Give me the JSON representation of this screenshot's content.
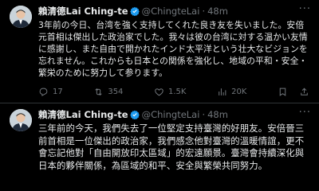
{
  "tweets": [
    {
      "author_name": "賴清德Lai Ching-te",
      "handle": "@ChingteLai",
      "separator": "·",
      "time": "48m",
      "more_label": "···",
      "text": "3年前の今日、台湾を強く支持してくれた良き友を失いました。安倍元首相は傑出した政治家でした。我々は彼の台湾に対する温かい友情に感謝し、また自由で開かれたインド太平洋という壮大なビジョンを忘れません。これからも日本との関係を強化し、地域の平和・安全・繁栄のために努力して参ります。",
      "stats": {
        "replies": "17",
        "retweets": "354",
        "likes": "1.5K",
        "views": "20K"
      }
    },
    {
      "author_name": "賴清德Lai Ching-te",
      "handle": "@ChingteLai",
      "separator": "·",
      "time": "48m",
      "more_label": "···",
      "text": "三年前的今天，我們失去了一位堅定支持臺灣的好朋友。安倍晉三前首相是一位傑出的政治家，我們感念他對臺灣的溫暖情誼，更不會忘記他對「自由開放印太區域」的宏遠願景。臺灣會持續深化與日本的夥伴關係，為區域的和平、安全與繁榮共同努力。"
    }
  ],
  "colors": {
    "background": "#000000",
    "text": "#e7e9ea",
    "muted": "#71767b",
    "verified_badge": "#1d9bf0",
    "divider": "#2f3336"
  },
  "icons": [
    "avatar",
    "verified-badge-icon",
    "more-icon",
    "reply-icon",
    "retweet-icon",
    "like-icon",
    "views-icon",
    "bookmark-icon",
    "share-icon"
  ]
}
